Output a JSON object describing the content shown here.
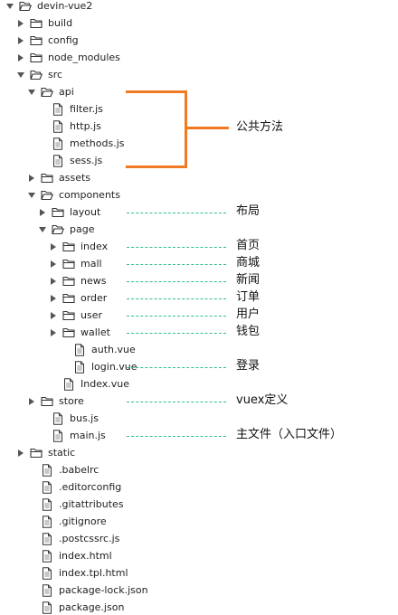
{
  "tree": [
    {
      "label": "devin-vue2",
      "kind": "folder",
      "depth": 0,
      "state": "expanded"
    },
    {
      "label": "build",
      "kind": "folder",
      "depth": 1,
      "state": "collapsed"
    },
    {
      "label": "config",
      "kind": "folder",
      "depth": 1,
      "state": "collapsed"
    },
    {
      "label": "node_modules",
      "kind": "folder",
      "depth": 1,
      "state": "collapsed"
    },
    {
      "label": "src",
      "kind": "folder",
      "depth": 1,
      "state": "expanded"
    },
    {
      "label": "api",
      "kind": "folder",
      "depth": 2,
      "state": "expanded"
    },
    {
      "label": "filter.js",
      "kind": "file",
      "depth": 3
    },
    {
      "label": "http.js",
      "kind": "file",
      "depth": 3
    },
    {
      "label": "methods.js",
      "kind": "file",
      "depth": 3
    },
    {
      "label": "sess.js",
      "kind": "file",
      "depth": 3
    },
    {
      "label": "assets",
      "kind": "folder",
      "depth": 2,
      "state": "collapsed"
    },
    {
      "label": "components",
      "kind": "folder",
      "depth": 2,
      "state": "expanded"
    },
    {
      "label": "layout",
      "kind": "folder",
      "depth": 3,
      "state": "collapsed"
    },
    {
      "label": "page",
      "kind": "folder",
      "depth": 3,
      "state": "expanded"
    },
    {
      "label": "index",
      "kind": "folder",
      "depth": 4,
      "state": "collapsed"
    },
    {
      "label": "mall",
      "kind": "folder",
      "depth": 4,
      "state": "collapsed"
    },
    {
      "label": "news",
      "kind": "folder",
      "depth": 4,
      "state": "collapsed"
    },
    {
      "label": "order",
      "kind": "folder",
      "depth": 4,
      "state": "collapsed"
    },
    {
      "label": "user",
      "kind": "folder",
      "depth": 4,
      "state": "collapsed"
    },
    {
      "label": "wallet",
      "kind": "folder",
      "depth": 4,
      "state": "collapsed"
    },
    {
      "label": "auth.vue",
      "kind": "file",
      "depth": 5
    },
    {
      "label": "login.vue",
      "kind": "file",
      "depth": 5
    },
    {
      "label": "Index.vue",
      "kind": "file",
      "depth": 4
    },
    {
      "label": "store",
      "kind": "folder",
      "depth": 2,
      "state": "collapsed"
    },
    {
      "label": "bus.js",
      "kind": "file",
      "depth": 3
    },
    {
      "label": "main.js",
      "kind": "file",
      "depth": 3
    },
    {
      "label": "static",
      "kind": "folder",
      "depth": 1,
      "state": "collapsed"
    },
    {
      "label": ".babelrc",
      "kind": "file",
      "depth": 2
    },
    {
      "label": ".editorconfig",
      "kind": "file",
      "depth": 2
    },
    {
      "label": ".gitattributes",
      "kind": "file",
      "depth": 2
    },
    {
      "label": ".gitignore",
      "kind": "file",
      "depth": 2
    },
    {
      "label": ".postcssrc.js",
      "kind": "file",
      "depth": 2
    },
    {
      "label": "index.html",
      "kind": "file",
      "depth": 2
    },
    {
      "label": "index.tpl.html",
      "kind": "file",
      "depth": 2
    },
    {
      "label": "package-lock.json",
      "kind": "file",
      "depth": 2
    },
    {
      "label": "package.json",
      "kind": "file",
      "depth": 2
    }
  ],
  "bracket_note": {
    "text": "公共方法",
    "row_from": 5,
    "row_to": 9
  },
  "annotations": [
    {
      "row": 12,
      "text": "布局"
    },
    {
      "row": 14,
      "text": "首页"
    },
    {
      "row": 15,
      "text": "商城"
    },
    {
      "row": 16,
      "text": "新闻"
    },
    {
      "row": 17,
      "text": "订单"
    },
    {
      "row": 18,
      "text": "用户"
    },
    {
      "row": 19,
      "text": "钱包"
    },
    {
      "row": 21,
      "text": "登录"
    },
    {
      "row": 23,
      "text": "vuex定义"
    },
    {
      "row": 25,
      "text": "主文件（入口文件）"
    }
  ],
  "colors": {
    "bracket": "#f07a22",
    "dashed_leader": "#2ec08a",
    "arrow": "#555555",
    "icon_stroke": "#333333"
  }
}
